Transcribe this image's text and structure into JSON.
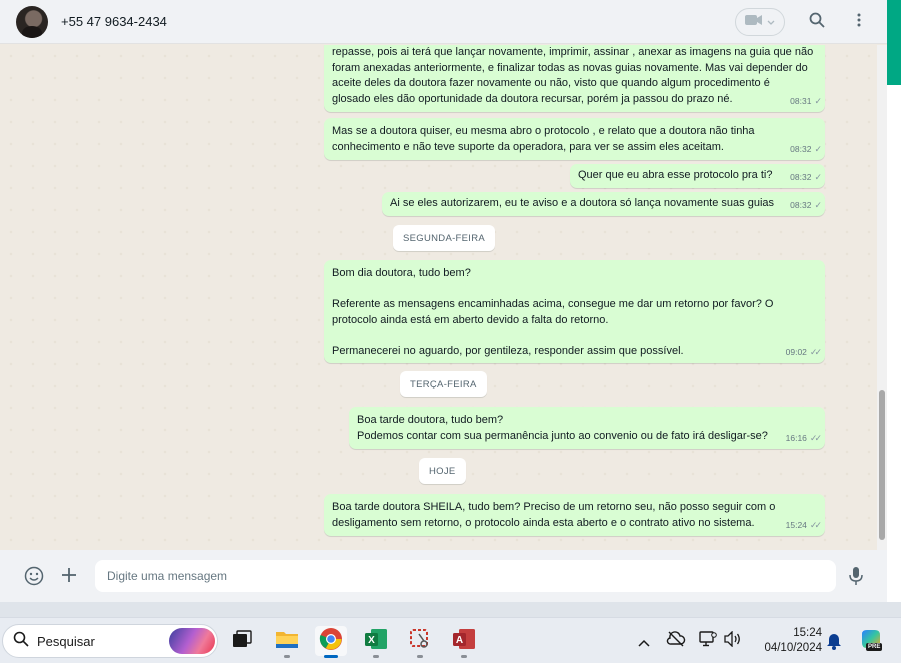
{
  "header": {
    "contact_name": "+55 47 9634-2434"
  },
  "messages": [
    {
      "text": "repasse, pois ai terá que lançar novamente, imprimir, assinar , anexar as imagens na guia que não\nforam anexadas anteriormente, e finalizar todas as novas guias novamente. Mas vai depender do\naceite deles da doutora fazer novamente ou não, visto que quando algum procedimento é\nglosado eles dão oportunidade da doutora recursar, porém ja passou do prazo né.",
      "time": "08:31",
      "status": "✓"
    },
    {
      "text": "Mas se a doutora quiser, eu mesma abro o protocolo , e relato que a doutora não tinha\nconhecimento e não teve suporte da operadora, para ver se assim eles aceitam.",
      "time": "08:32",
      "status": "✓"
    },
    {
      "text": "Quer que eu abra esse protocolo pra ti?",
      "time": "08:32",
      "status": "✓"
    },
    {
      "text": "Ai se eles autorizarem, eu te aviso e a doutora só lança novamente suas guias",
      "time": "08:32",
      "status": "✓"
    },
    {
      "text": "Bom dia doutora, tudo bem?\n\nReferente as mensagens encaminhadas acima, consegue me dar um retorno por favor? O\nprotocolo ainda está em aberto devido a falta do retorno.\n\nPermanecerei no aguardo, por gentileza, responder assim que possível.",
      "time": "09:02",
      "status": "✓✓"
    },
    {
      "text": "Boa tarde doutora, tudo bem?\nPodemos contar com sua permanência junto ao convenio ou de fato irá desligar-se?",
      "time": "16:16",
      "status": "✓✓"
    },
    {
      "text": "Boa tarde doutora SHEILA, tudo bem? Preciso de um retorno seu, não posso seguir com o\ndesligamento sem retorno, o protocolo ainda esta aberto e o contrato ativo no sistema.",
      "time": "15:24",
      "status": "✓✓"
    }
  ],
  "date_separators": [
    "SEGUNDA-FEIRA",
    "TERÇA-FEIRA",
    "HOJE"
  ],
  "composer": {
    "placeholder": "Digite uma mensagem"
  },
  "taskbar": {
    "search_label": "Pesquisar",
    "time": "15:24",
    "date": "04/10/2024",
    "copilot_badge": "PRE"
  },
  "colors": {
    "outgoing_bubble": "#d9fdd3",
    "accent": "#00a884",
    "chat_background": "#efeae2"
  }
}
